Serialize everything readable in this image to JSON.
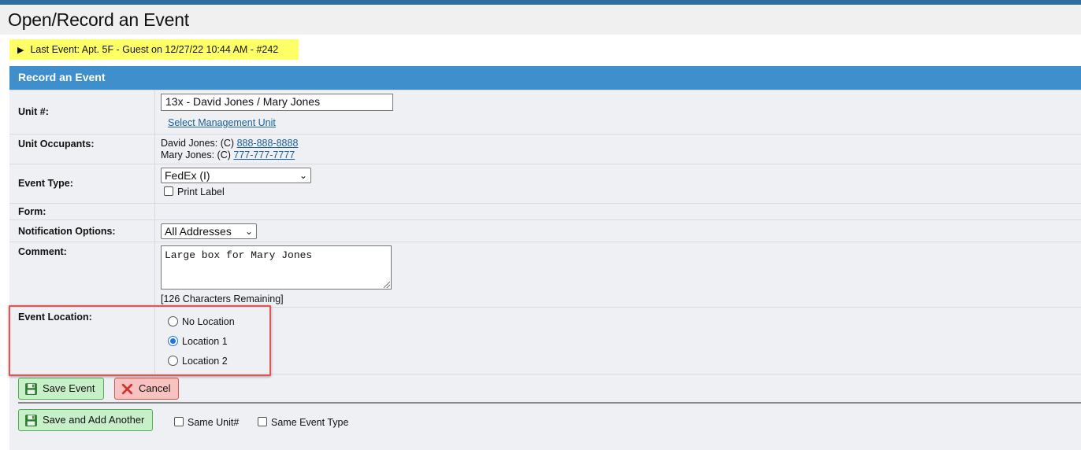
{
  "page": {
    "title": "Open/Record an Event"
  },
  "last_event": {
    "text": "Last Event: Apt. 5F - Guest on 12/27/22 10:44 AM - #242"
  },
  "panel": {
    "header": "Record an Event"
  },
  "form": {
    "unit": {
      "label": "Unit #:",
      "value": "13x - David Jones / Mary Jones",
      "link": "Select Management Unit"
    },
    "occupants": {
      "label": "Unit Occupants:",
      "list": [
        {
          "name": "David Jones: (C) ",
          "phone": "888-888-8888"
        },
        {
          "name": "Mary Jones: (C) ",
          "phone": "777-777-7777"
        }
      ]
    },
    "event_type": {
      "label": "Event Type:",
      "selected": "FedEx (I)",
      "print_label": "Print Label",
      "print_checked": false
    },
    "form_row": {
      "label": "Form:"
    },
    "notification": {
      "label": "Notification Options:",
      "selected": "All Addresses"
    },
    "comment": {
      "label": "Comment:",
      "value": "Large box for Mary Jones",
      "remaining": "[126 Characters Remaining]"
    },
    "location": {
      "label": "Event Location:",
      "options": [
        {
          "label": "No Location",
          "checked": false
        },
        {
          "label": "Location 1",
          "checked": true
        },
        {
          "label": "Location 2",
          "checked": false
        }
      ]
    }
  },
  "actions": {
    "save": "Save Event",
    "cancel": "Cancel",
    "save_add": "Save and Add Another",
    "same_unit": "Same Unit#",
    "same_type": "Same Event Type"
  },
  "colors": {
    "header_blue": "#3f8fcc",
    "highlight_yellow": "#ffff66",
    "annotation_red": "#e05555"
  },
  "icons": {
    "save": "floppy-disk-icon",
    "cancel": "x-icon",
    "expand": "triangle-right-icon"
  }
}
